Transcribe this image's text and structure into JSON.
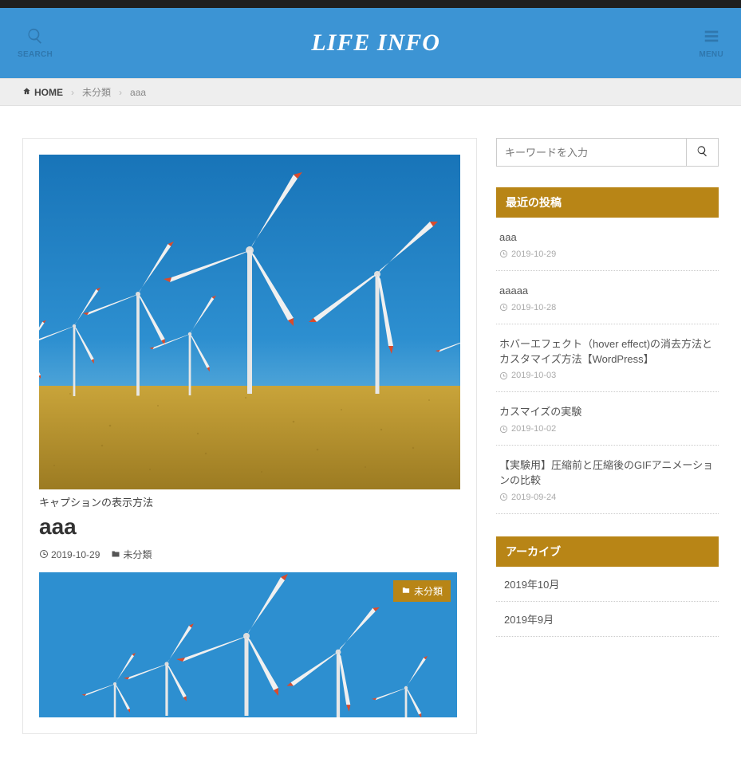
{
  "header": {
    "searchLabel": "SEARCH",
    "menuLabel": "MENU",
    "siteTitle": "LIFE INFO"
  },
  "breadcrumb": {
    "home": "HOME",
    "cat": "未分類",
    "current": "aaa"
  },
  "post": {
    "caption": "キャプションの表示方法",
    "title": "aaa",
    "date": "2019-10-29",
    "category": "未分類",
    "badge": "未分類"
  },
  "sidebar": {
    "searchPlaceholder": "キーワードを入力",
    "recentTitle": "最近の投稿",
    "recent": [
      {
        "title": "aaa",
        "date": "2019-10-29"
      },
      {
        "title": "aaaaa",
        "date": "2019-10-28"
      },
      {
        "title": "ホバーエフェクト（hover effect)の消去方法とカスタマイズ方法【WordPress】",
        "date": "2019-10-03"
      },
      {
        "title": "カスマイズの実験",
        "date": "2019-10-02"
      },
      {
        "title": "【実験用】圧縮前と圧縮後のGIFアニメーションの比較",
        "date": "2019-09-24"
      }
    ],
    "archiveTitle": "アーカイブ",
    "archives": [
      "2019年10月",
      "2019年9月"
    ]
  }
}
